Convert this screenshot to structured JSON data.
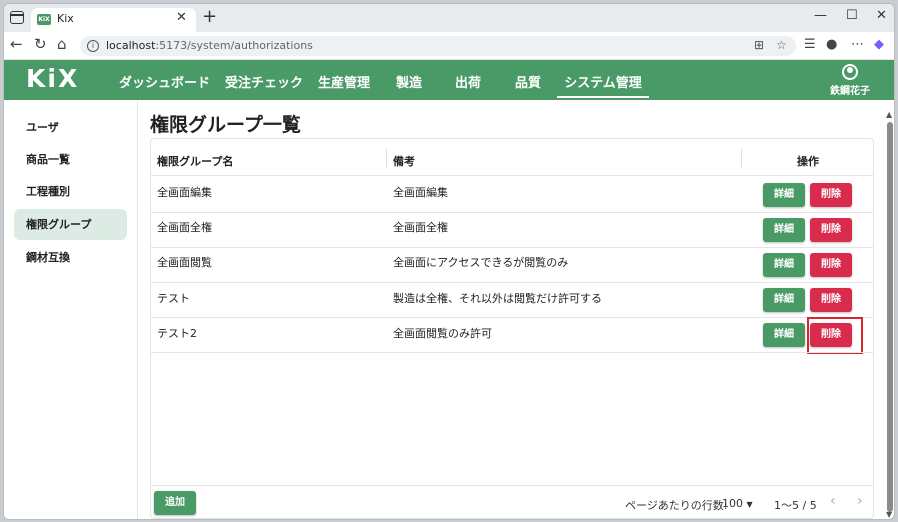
{
  "browser": {
    "tab_title": "Kix",
    "tab_close": "✕",
    "new_tab": "+",
    "window_controls": {
      "minimize": "—",
      "maximize": "☐",
      "close": "✕"
    },
    "url_host": "localhost",
    "url_path": ":5173/system/authorizations"
  },
  "app": {
    "logo": "KiX",
    "nav": [
      {
        "label": "ダッシュボード"
      },
      {
        "label": "受注チェック"
      },
      {
        "label": "生産管理"
      },
      {
        "label": "製造"
      },
      {
        "label": "出荷"
      },
      {
        "label": "品質"
      },
      {
        "label": "システム管理",
        "active": true
      }
    ],
    "user_name": "鉄鋼花子"
  },
  "sidebar": {
    "items": [
      {
        "label": "ユーザ"
      },
      {
        "label": "商品一覧"
      },
      {
        "label": "工程種別"
      },
      {
        "label": "権限グループ",
        "active": true
      },
      {
        "label": "鋼材互換"
      }
    ]
  },
  "main": {
    "title": "権限グループ一覧",
    "table": {
      "headers": {
        "name": "権限グループ名",
        "note": "備考",
        "actions": "操作"
      },
      "rows": [
        {
          "name": "全画面編集",
          "note": "全画面編集"
        },
        {
          "name": "全画面全権",
          "note": "全画面全権"
        },
        {
          "name": "全画面閲覧",
          "note": "全画面にアクセスできるが閲覧のみ"
        },
        {
          "name": "テスト",
          "note": "製造は全権、それ以外は閲覧だけ許可する"
        },
        {
          "name": "テスト2",
          "note": "全画面閲覧のみ許可"
        }
      ],
      "detail_label": "詳細",
      "delete_label": "削除"
    },
    "add_label": "追加",
    "pagination": {
      "rows_per_page_label": "ページあたりの行数:",
      "rows_per_page_value": "100",
      "range": "1〜5 / 5"
    }
  },
  "colors": {
    "primary_green": "#4a9a67",
    "delete_red": "#d92b4b",
    "highlight_red": "#d8262c"
  }
}
